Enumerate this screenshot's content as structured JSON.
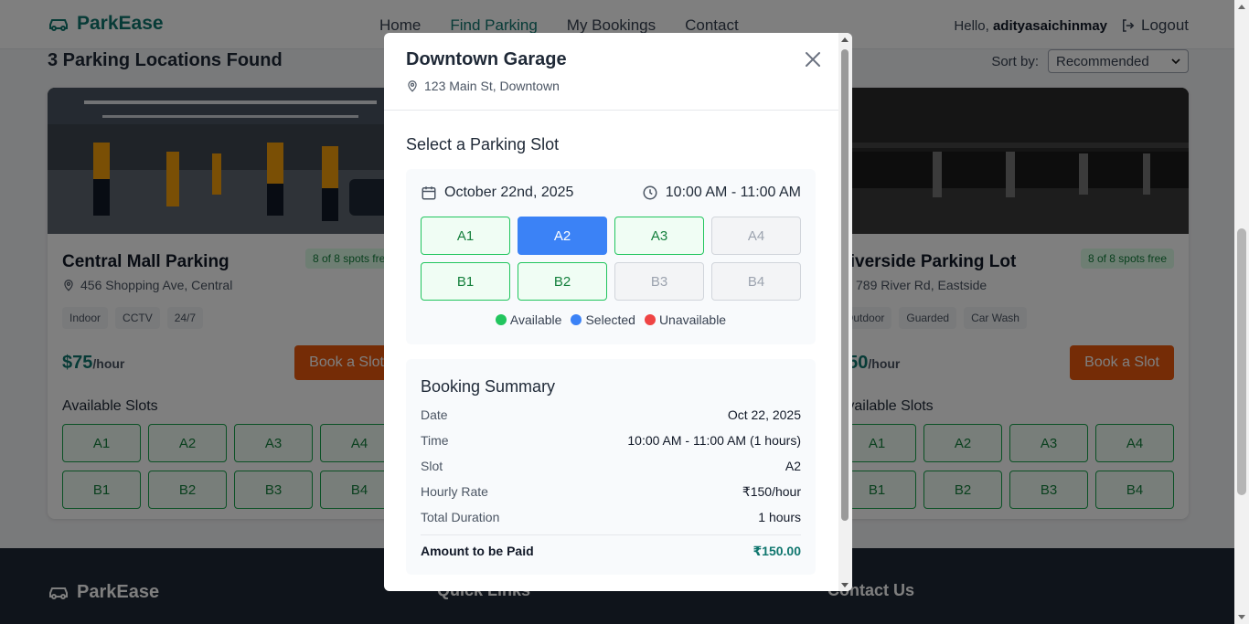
{
  "navbar": {
    "brand": "ParkEase",
    "links": [
      "Home",
      "Find Parking",
      "My Bookings",
      "Contact"
    ],
    "greeting": "Hello,",
    "username": "adityasaichinmay",
    "logout": "Logout"
  },
  "results": {
    "title": "3 Parking Locations Found",
    "sort_label": "Sort by:",
    "sort_value": "Recommended"
  },
  "cards": [
    {
      "name": "Central Mall Parking",
      "badge": "8 of 8 spots free",
      "address": "456 Shopping Ave, Central",
      "tags": [
        "Indoor",
        "CCTV",
        "24/7"
      ],
      "price": "$75",
      "price_unit": "/hour",
      "book_label": "Book a Slot",
      "slots_title": "Available Slots",
      "slots": [
        "A1",
        "A2",
        "A3",
        "A4",
        "B1",
        "B2",
        "B3",
        "B4"
      ]
    },
    {
      "name": "Riverside Parking Lot",
      "badge": "8 of 8 spots free",
      "address": "789 River Rd, Eastside",
      "tags": [
        "Outdoor",
        "Guarded",
        "Car Wash"
      ],
      "price": "$50",
      "price_unit": "/hour",
      "book_label": "Book a Slot",
      "slots_title": "Available Slots",
      "slots": [
        "A1",
        "A2",
        "A3",
        "A4",
        "B1",
        "B2",
        "B3",
        "B4"
      ]
    }
  ],
  "footer": {
    "brand": "ParkEase",
    "quick_links": "Quick Links",
    "contact": "Contact Us"
  },
  "modal": {
    "title": "Downtown Garage",
    "address": "123 Main St, Downtown",
    "section_title": "Select a Parking Slot",
    "date": "October 22nd, 2025",
    "time": "10:00 AM - 11:00 AM",
    "slots": [
      {
        "label": "A1",
        "state": "available"
      },
      {
        "label": "A2",
        "state": "selected"
      },
      {
        "label": "A3",
        "state": "available"
      },
      {
        "label": "A4",
        "state": "unavailable"
      },
      {
        "label": "B1",
        "state": "available"
      },
      {
        "label": "B2",
        "state": "available"
      },
      {
        "label": "B3",
        "state": "unavailable"
      },
      {
        "label": "B4",
        "state": "unavailable"
      }
    ],
    "legend": {
      "available": "Available",
      "selected": "Selected",
      "unavailable": "Unavailable"
    },
    "summary": {
      "title": "Booking Summary",
      "rows": [
        {
          "k": "Date",
          "v": "Oct 22, 2025"
        },
        {
          "k": "Time",
          "v": "10:00 AM - 11:00 AM (1 hours)"
        },
        {
          "k": "Slot",
          "v": "A2"
        },
        {
          "k": "Hourly Rate",
          "v": "₹150/hour"
        },
        {
          "k": "Total Duration",
          "v": "1 hours"
        }
      ],
      "total_label": "Amount to be Paid",
      "total_value": "₹150.00"
    }
  },
  "colors": {
    "brand": "#0f766e",
    "accent_orange": "#ea580c",
    "selected_blue": "#3b82f6",
    "available_green": "#22c55e",
    "unavailable_red": "#ef4444"
  }
}
